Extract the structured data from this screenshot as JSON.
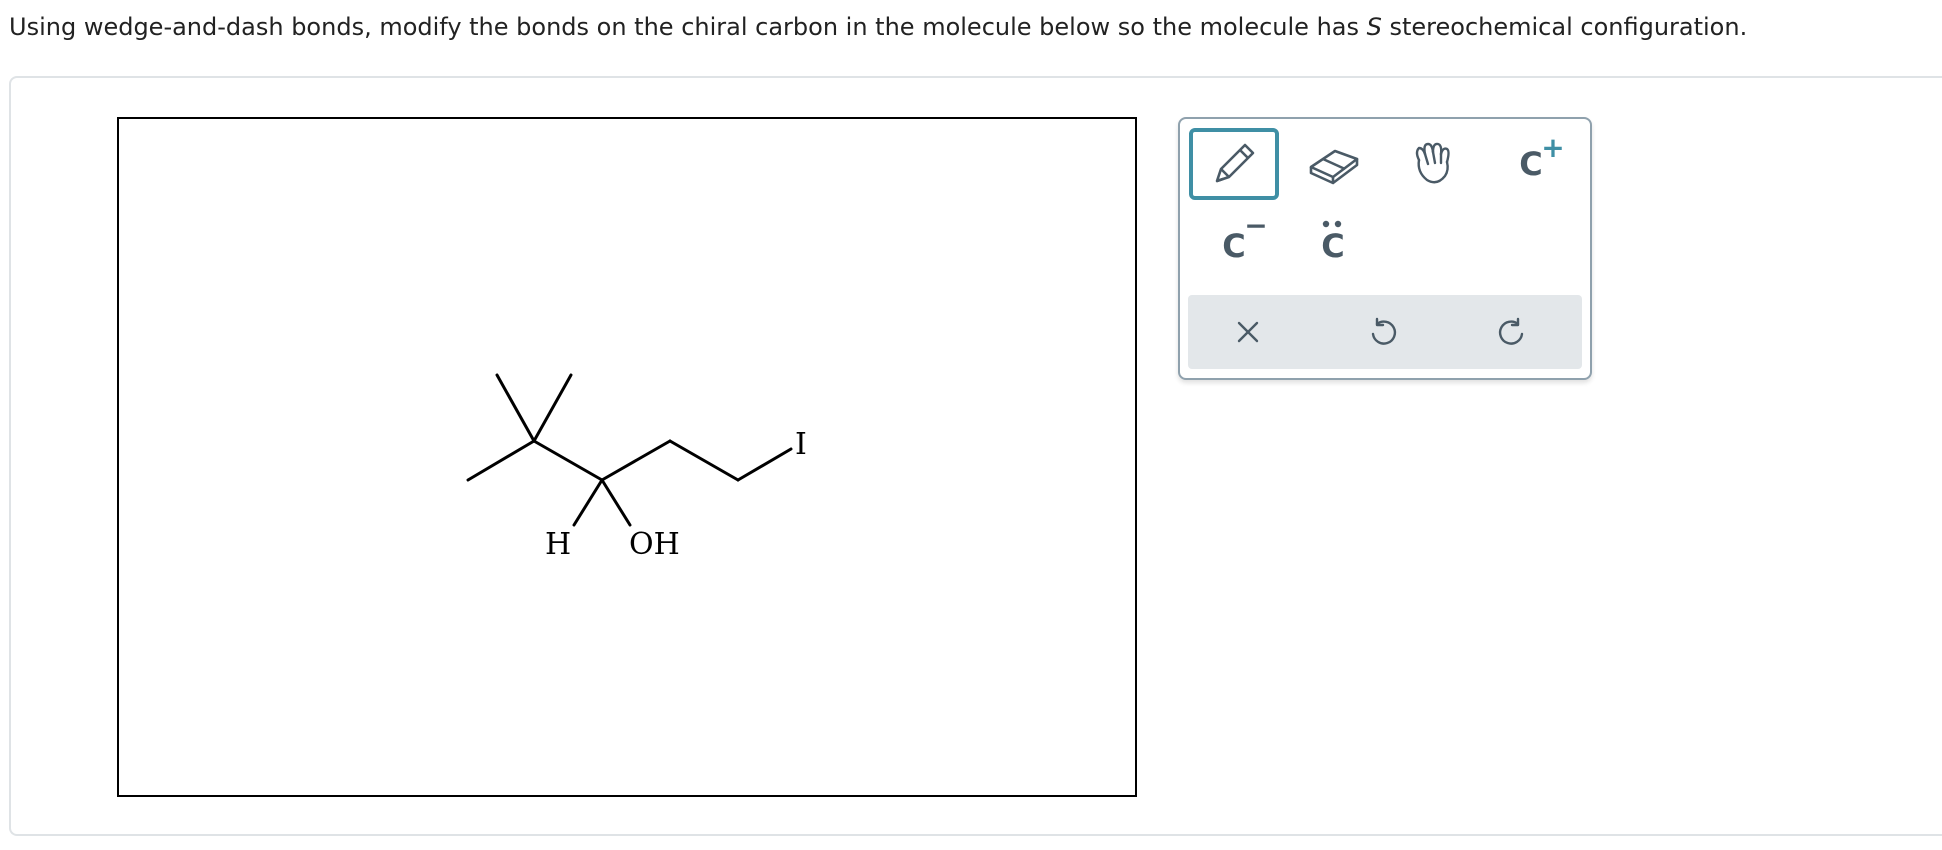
{
  "question": {
    "before": "Using wedge-and-dash bonds, modify the bonds on the chiral carbon in the molecule below so the molecule has ",
    "emphasis": "S",
    "after": " stereochemical configuration."
  },
  "molecule": {
    "label_h": "H",
    "label_oh": "OH",
    "label_i": "I"
  },
  "toolbox": {
    "tools": [
      {
        "name": "pencil",
        "icon": "pencil-icon",
        "selected": true
      },
      {
        "name": "eraser",
        "icon": "eraser-icon",
        "selected": false
      },
      {
        "name": "hand",
        "icon": "hand-icon",
        "selected": false
      },
      {
        "name": "carbocation",
        "label": "C",
        "charge": "+"
      },
      {
        "name": "carbanion",
        "label": "C",
        "charge": "−"
      },
      {
        "name": "lone-pair",
        "label": "C",
        "dots": "••"
      }
    ],
    "carbocation_label": "C",
    "carbocation_charge": "+",
    "carbanion_label": "C",
    "carbanion_charge": "−",
    "lonepair_label": "C",
    "actions": [
      {
        "name": "clear",
        "icon": "close-icon"
      },
      {
        "name": "undo",
        "icon": "undo-icon"
      },
      {
        "name": "redo",
        "icon": "redo-icon"
      }
    ]
  },
  "colors": {
    "accent": "#3f8fa5",
    "icon": "#4a5a66",
    "action_bar": "#e3e7ea",
    "toolbox_border": "#8fa1ad"
  }
}
